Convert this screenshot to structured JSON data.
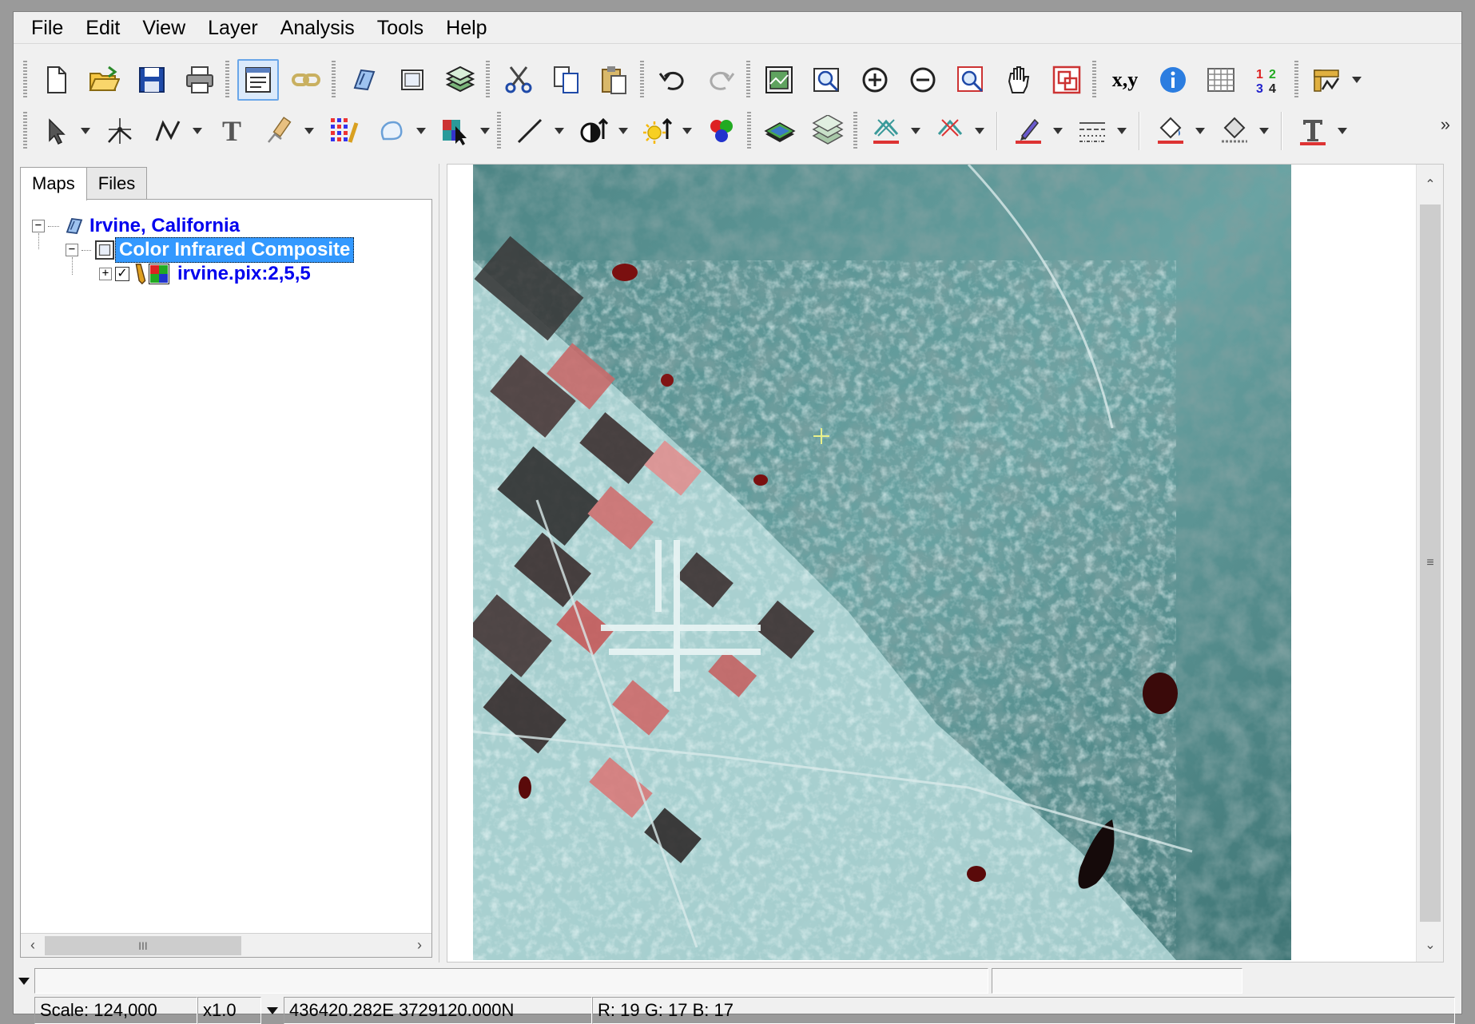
{
  "menubar": {
    "items": [
      "File",
      "Edit",
      "View",
      "Layer",
      "Analysis",
      "Tools",
      "Help"
    ]
  },
  "toolbar": {
    "coord_tool_label": "x,y",
    "numbers_tool_label": "1 2 3 4",
    "text_tool_label": "T",
    "overflow_label": "»"
  },
  "left_panel": {
    "tabs": [
      "Maps",
      "Files"
    ],
    "selected_tab": "Maps",
    "tree": {
      "project": "Irvine, California",
      "map": "Color Infrared Composite",
      "layer": "irvine.pix:2,5,5",
      "layer_checked": true
    },
    "hscroll_grip": "III"
  },
  "map_view": {
    "vscroll_grip": "≡"
  },
  "status": {
    "scale": "Scale: 124,000",
    "zoom": "x1.0",
    "coordinates": "436420.282E 3729120.000N",
    "rgb": "R: 19 G: 17 B: 17"
  },
  "colors": {
    "selection": "#3399ff",
    "tree_link": "#0000ee",
    "map_vegetation": "#5e9090",
    "map_urban": "#c9e6e6",
    "map_infrared_red": "#c65a5a"
  },
  "icons": [
    "new-icon",
    "open-icon",
    "save-icon",
    "print-icon",
    "properties-icon",
    "link-icon",
    "map-icon",
    "area-icon",
    "layers-icon",
    "cut-icon",
    "copy-icon",
    "paste-icon",
    "undo-icon",
    "redo-icon",
    "zoom-extent-icon",
    "zoom-layer-icon",
    "zoom-in-icon",
    "zoom-out-icon",
    "zoom-window-icon",
    "pan-icon",
    "overview-icon",
    "coordinates-icon",
    "info-icon",
    "table-icon",
    "numbers-icon",
    "ruler-icon"
  ]
}
